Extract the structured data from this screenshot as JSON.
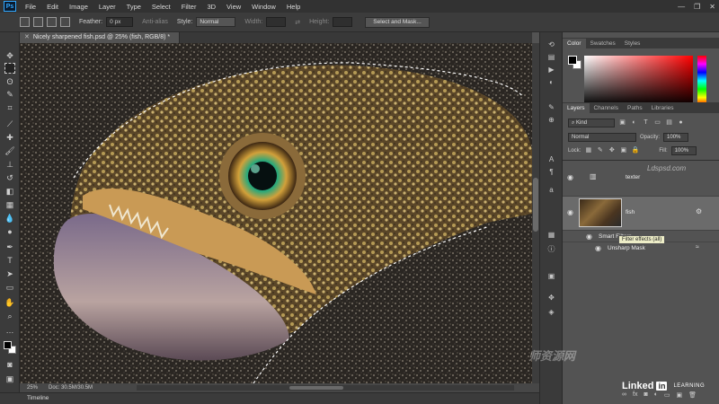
{
  "menubar": {
    "logo": "Ps",
    "items": [
      "File",
      "Edit",
      "Image",
      "Layer",
      "Type",
      "Select",
      "Filter",
      "3D",
      "View",
      "Window",
      "Help"
    ],
    "window_controls": [
      "—",
      "❐",
      "✕"
    ]
  },
  "options_bar": {
    "feather_label": "Feather:",
    "feather_value": "0 px",
    "anti_alias_label": "Anti-alias",
    "style_label": "Style:",
    "style_value": "Normal",
    "width_label": "Width:",
    "height_label": "Height:",
    "select_mask_button": "Select and Mask..."
  },
  "document": {
    "tab_title": "Nicely sharpened fish.psd @ 25% (fish, RGB/8) *",
    "zoom": "25%",
    "doc_info": "Doc: 30.5M/30.5M"
  },
  "timeline_label": "Timeline",
  "color_panel": {
    "tabs": [
      "Color",
      "Swatches",
      "Styles"
    ],
    "fg_color": "#000000",
    "bg_color": "#ffffff"
  },
  "layers_panel": {
    "tabs": [
      "Layers",
      "Channels",
      "Paths",
      "Libraries"
    ],
    "kind_label": "Kind",
    "blend_mode": "Normal",
    "opacity_label": "Opacity:",
    "opacity_value": "100%",
    "lock_label": "Lock:",
    "fill_label": "Fill:",
    "fill_value": "100%",
    "layers": [
      {
        "name": "texter"
      },
      {
        "name": "fish"
      },
      {
        "name": "Smart Filters"
      },
      {
        "name": "Unsharp Mask"
      }
    ],
    "tooltip": "Filter effects (all)"
  },
  "watermarks": {
    "ldspsd": "Ldspsd.com",
    "linkedin_text": "Linked",
    "linkedin_box": "in",
    "learning": "LEARNING",
    "cn_text": "师资源网"
  }
}
